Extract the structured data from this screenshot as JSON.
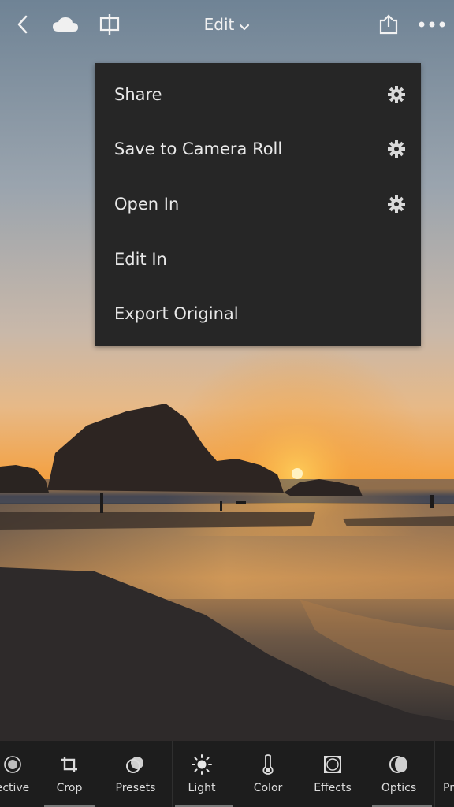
{
  "header": {
    "title": "Edit",
    "icons": [
      "back-icon",
      "cloud-icon",
      "compare-icon",
      "chevron-down-icon",
      "share-icon",
      "more-icon"
    ]
  },
  "share_menu": {
    "items": [
      {
        "label": "Share",
        "has_settings": true
      },
      {
        "label": "Save to Camera Roll",
        "has_settings": true
      },
      {
        "label": "Open In",
        "has_settings": true
      },
      {
        "label": "Edit In",
        "has_settings": false
      },
      {
        "label": "Export Original",
        "has_settings": false
      }
    ]
  },
  "toolbar": {
    "tools": [
      {
        "label": "ective",
        "icon": "selective-icon"
      },
      {
        "label": "Crop",
        "icon": "crop-icon",
        "active": true
      },
      {
        "label": "Presets",
        "icon": "presets-icon"
      },
      {
        "label": "Light",
        "icon": "light-icon",
        "active": true
      },
      {
        "label": "Color",
        "icon": "color-icon"
      },
      {
        "label": "Effects",
        "icon": "effects-icon"
      },
      {
        "label": "Optics",
        "icon": "optics-icon",
        "active": true
      },
      {
        "label": "Pr",
        "icon": "profile-icon"
      }
    ]
  },
  "colors": {
    "menu_bg": "#262626",
    "toolbar_bg": "#1d1d1d",
    "text": "#e9e9e9"
  }
}
